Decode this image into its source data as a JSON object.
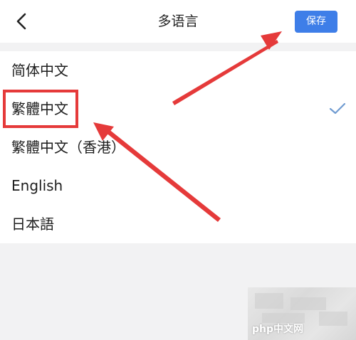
{
  "header": {
    "title": "多语言",
    "back_icon": "chevron-left-icon",
    "save_label": "保存"
  },
  "languages": [
    {
      "label": "简体中文",
      "selected": false
    },
    {
      "label": "繁體中文",
      "selected": true
    },
    {
      "label": "繁體中文（香港）",
      "selected": false
    },
    {
      "label": "English",
      "selected": false
    },
    {
      "label": "日本語",
      "selected": false
    }
  ],
  "check_icon": "checkmark-icon",
  "watermark": {
    "text": "php中文网"
  },
  "colors": {
    "accent": "#3e7ee8",
    "check": "#6f9bd1",
    "annotation": "#e53a3a",
    "background": "#f2f2f3"
  }
}
